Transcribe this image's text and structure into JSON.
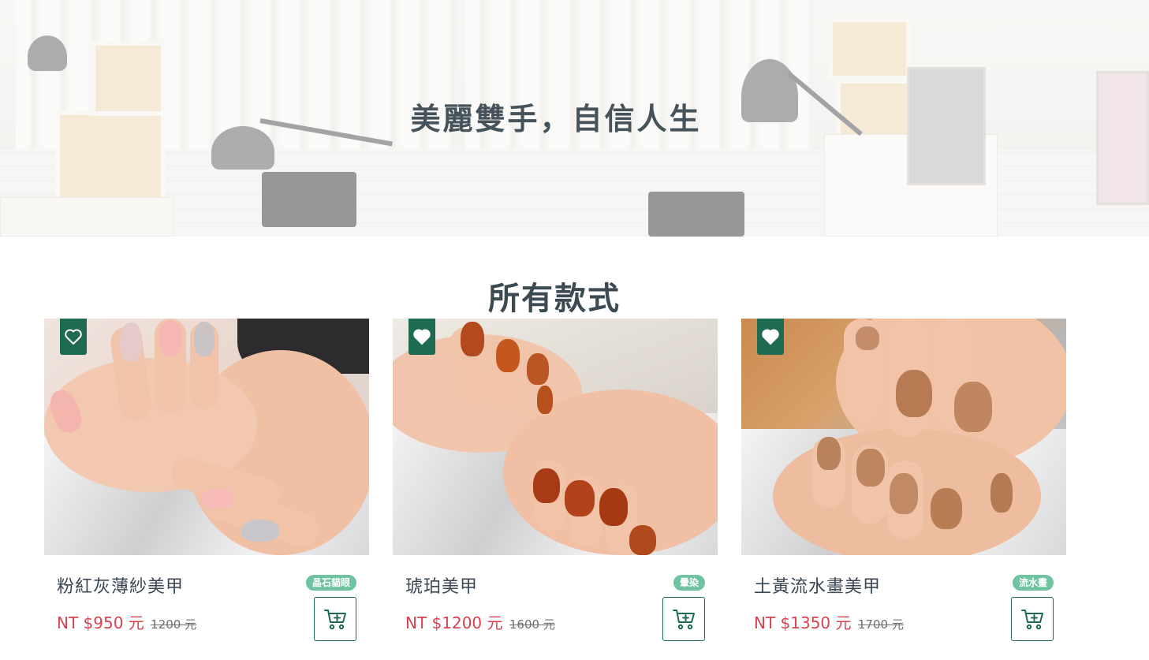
{
  "hero": {
    "title": "美麗雙手，自信人生"
  },
  "section": {
    "title": "所有款式"
  },
  "colors": {
    "brand_green": "#1f6b52",
    "tag_green": "#6fc3a0",
    "price_red": "#d9414f"
  },
  "products": [
    {
      "name": "粉紅灰薄紗美甲",
      "tag": "晶石貓眼",
      "price": "NT $950 元",
      "original_price": "1200 元",
      "favorited": false,
      "favorite_icon": "heart-outline-icon",
      "cart_icon": "cart-plus-icon"
    },
    {
      "name": "琥珀美甲",
      "tag": "暈染",
      "price": "NT $1200 元",
      "original_price": "1600 元",
      "favorited": true,
      "favorite_icon": "heart-filled-icon",
      "cart_icon": "cart-plus-icon"
    },
    {
      "name": "土黃流水畫美甲",
      "tag": "流水畫",
      "price": "NT $1350 元",
      "original_price": "1700 元",
      "favorited": true,
      "favorite_icon": "heart-filled-icon",
      "cart_icon": "cart-plus-icon"
    }
  ]
}
